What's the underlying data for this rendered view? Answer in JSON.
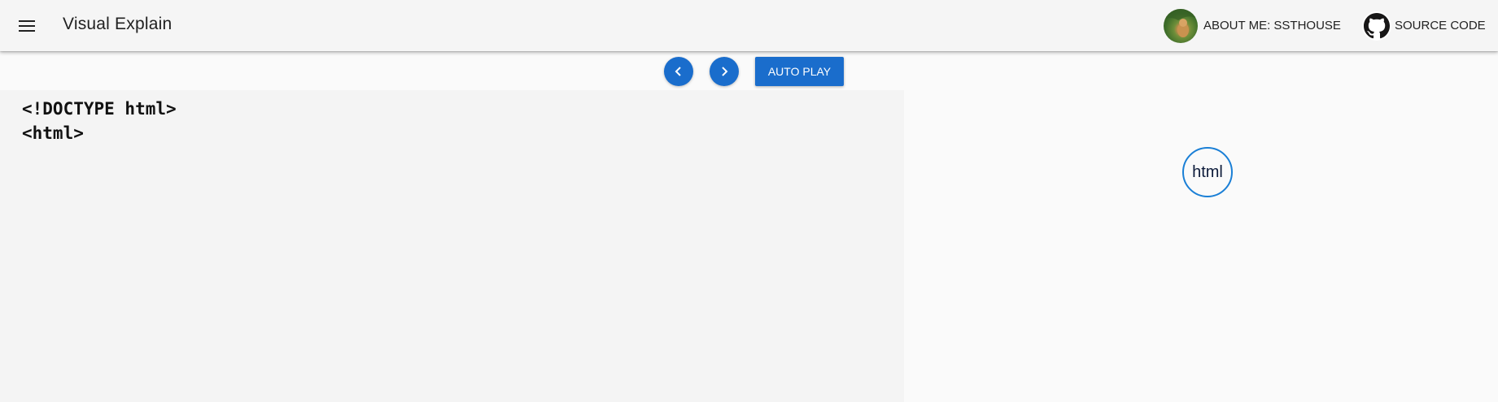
{
  "header": {
    "title": "Visual Explain",
    "menu_icon": "hamburger-menu-icon",
    "about_label": "ABOUT ME: SSTHOUSE",
    "source_label": "SOURCE CODE",
    "source_icon": "github-icon"
  },
  "controls": {
    "prev_icon": "chevron-left-icon",
    "next_icon": "chevron-right-icon",
    "autoplay_label": "AUTO PLAY",
    "accent_color": "#1a6dcc"
  },
  "code": {
    "lines": [
      "<!DOCTYPE html>",
      "<html>"
    ]
  },
  "tree": {
    "nodes": [
      {
        "label": "html"
      }
    ],
    "node_border_color": "#1a7fd6"
  }
}
